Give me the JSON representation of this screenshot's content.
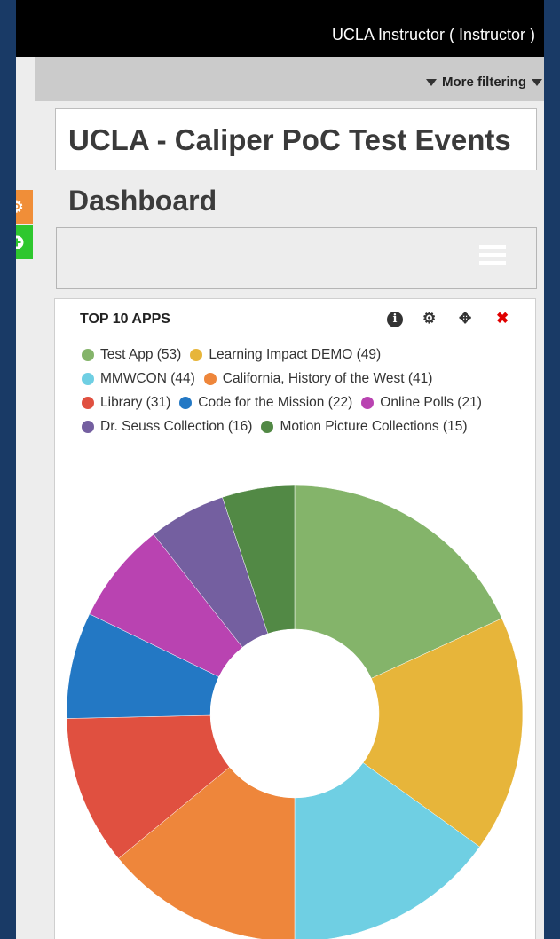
{
  "header": {
    "user": "UCLA Instructor ( Instructor )"
  },
  "filter": {
    "label": "More filtering"
  },
  "course": {
    "title": "UCLA - Caliper PoC Test Events"
  },
  "page": {
    "title": "Dashboard"
  },
  "sidebar": {
    "settings_icon": "gear-icon",
    "add_icon": "plus-circle-icon"
  },
  "widget": {
    "title": "TOP 10 APPS",
    "icons": [
      "info-icon",
      "gear-icon",
      "move-icon",
      "close-icon"
    ]
  },
  "legend_rows": [
    [
      {
        "label": "Test App (53)",
        "color": "#84b46a"
      },
      {
        "label": "Learning Impact DEMO (49)",
        "color": "#e7b53a"
      }
    ],
    [
      {
        "label": "MMWCON (44)",
        "color": "#6fcfe3"
      },
      {
        "label": "California, History of the West (41)",
        "color": "#ee863b"
      }
    ],
    [
      {
        "label": "Library (31)",
        "color": "#e05040"
      },
      {
        "label": "Code for the Mission (22)",
        "color": "#2378c4"
      },
      {
        "label": "Online Polls (21)",
        "color": "#b943b1"
      }
    ],
    [
      {
        "label": "Dr. Seuss Collection (16)",
        "color": "#745fa0"
      },
      {
        "label": "Motion Picture Collections (15)",
        "color": "#528945"
      }
    ]
  ],
  "chart_data": {
    "type": "pie",
    "title": "TOP 10 APPS",
    "categories": [
      "Test App",
      "Learning Impact DEMO",
      "MMWCON",
      "California, History of the West",
      "Library",
      "Code for the Mission",
      "Online Polls",
      "Dr. Seuss Collection",
      "Motion Picture Collections"
    ],
    "values": [
      53,
      49,
      44,
      41,
      31,
      22,
      21,
      16,
      15
    ],
    "colors": [
      "#84b46a",
      "#e7b53a",
      "#6fcfe3",
      "#ee863b",
      "#e05040",
      "#2378c4",
      "#b943b1",
      "#745fa0",
      "#528945"
    ],
    "legend": "top"
  }
}
